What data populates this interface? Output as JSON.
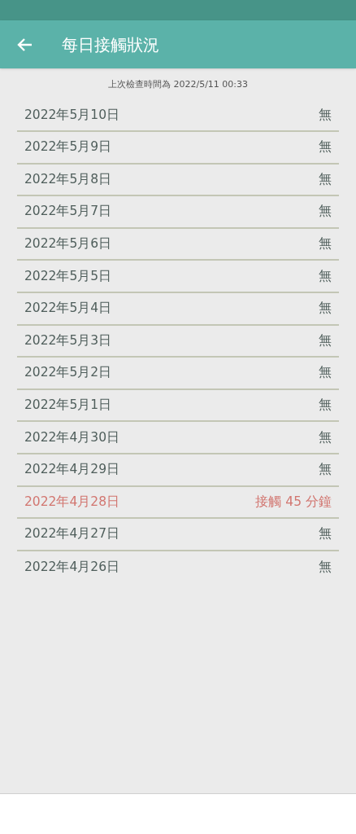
{
  "app_bar": {
    "title": "每日接觸狀況"
  },
  "last_check": "上次檢查時間為 2022/5/11 00:33",
  "days": [
    {
      "date": "2022年5月10日",
      "status": "無",
      "contact": false
    },
    {
      "date": "2022年5月9日",
      "status": "無",
      "contact": false
    },
    {
      "date": "2022年5月8日",
      "status": "無",
      "contact": false
    },
    {
      "date": "2022年5月7日",
      "status": "無",
      "contact": false
    },
    {
      "date": "2022年5月6日",
      "status": "無",
      "contact": false
    },
    {
      "date": "2022年5月5日",
      "status": "無",
      "contact": false
    },
    {
      "date": "2022年5月4日",
      "status": "無",
      "contact": false
    },
    {
      "date": "2022年5月3日",
      "status": "無",
      "contact": false
    },
    {
      "date": "2022年5月2日",
      "status": "無",
      "contact": false
    },
    {
      "date": "2022年5月1日",
      "status": "無",
      "contact": false
    },
    {
      "date": "2022年4月30日",
      "status": "無",
      "contact": false
    },
    {
      "date": "2022年4月29日",
      "status": "無",
      "contact": false
    },
    {
      "date": "2022年4月28日",
      "status": "接觸 45 分鐘",
      "contact": true
    },
    {
      "date": "2022年4月27日",
      "status": "無",
      "contact": false
    },
    {
      "date": "2022年4月26日",
      "status": "無",
      "contact": false
    }
  ]
}
